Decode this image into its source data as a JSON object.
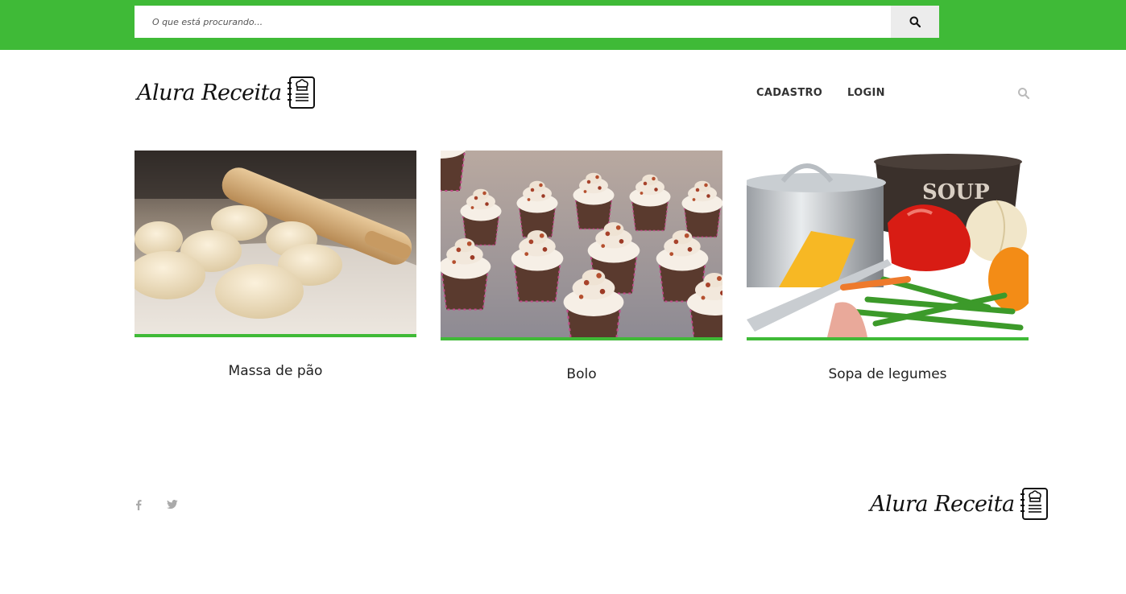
{
  "search": {
    "placeholder": "O que está procurando..."
  },
  "header": {
    "logo_text": "Alura Receita",
    "nav": [
      {
        "label": "CADASTRO"
      },
      {
        "label": "LOGIN"
      }
    ]
  },
  "recipes": [
    {
      "title": "Massa de pão"
    },
    {
      "title": "Bolo"
    },
    {
      "title": "Sopa de legumes",
      "image_text": "SOUP"
    }
  ],
  "footer": {
    "logo_text": "Alura Receita"
  },
  "colors": {
    "accent": "#3fba37"
  }
}
